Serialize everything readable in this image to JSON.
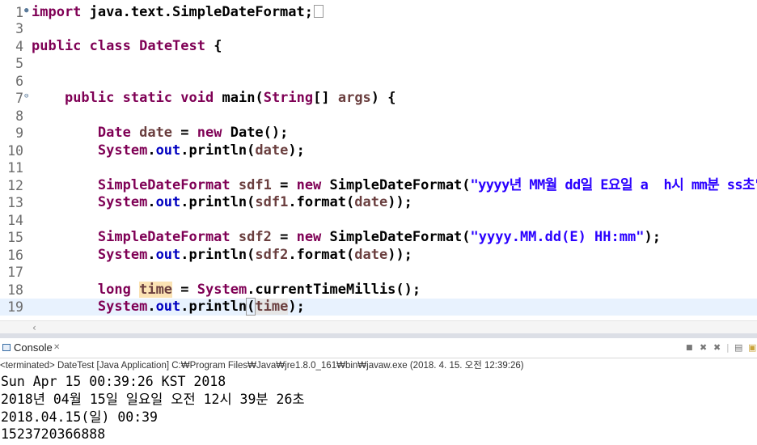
{
  "editor": {
    "line_numbers": [
      "1",
      "3",
      "4",
      "5",
      "6",
      "7",
      "8",
      "9",
      "10",
      "11",
      "12",
      "13",
      "14",
      "15",
      "16",
      "17",
      "18",
      "19"
    ],
    "l1": {
      "kw": "import",
      "rest": " java.text.SimpleDateFormat;"
    },
    "l4": {
      "kw1": "public",
      "kw2": "class",
      "name": "DateTest",
      "brace": " {"
    },
    "l7": {
      "kw1": "public",
      "kw2": "static",
      "kw3": "void",
      "method": "main",
      "p1": "(",
      "type": "String",
      "p2": "[] ",
      "arg": "args",
      "p3": ") {"
    },
    "l9": {
      "type": "Date",
      "var": "date",
      "eq": " = ",
      "kw": "new",
      "rest": " Date();"
    },
    "l10": {
      "cls": "System",
      "dot": ".",
      "field": "out",
      "call": ".println(",
      "var": "date",
      "end": ");"
    },
    "l12": {
      "type": "SimpleDateFormat",
      "var": "sdf1",
      "eq": " = ",
      "kw": "new",
      "ctor": " SimpleDateFormat(",
      "str": "\"yyyy년 MM월 dd일 E요일 a  h시 mm분 ss초\"",
      "end": ");"
    },
    "l13": {
      "cls": "System",
      "dot": ".",
      "field": "out",
      "call": ".println(",
      "var": "sdf1",
      "fmt": ".format(",
      "arg": "date",
      "end": "));"
    },
    "l15": {
      "type": "SimpleDateFormat",
      "var": "sdf2",
      "eq": " = ",
      "kw": "new",
      "ctor": " SimpleDateFormat(",
      "str": "\"yyyy.MM.dd(E) HH:mm\"",
      "end": ");"
    },
    "l16": {
      "cls": "System",
      "dot": ".",
      "field": "out",
      "call": ".println(",
      "var": "sdf2",
      "fmt": ".format(",
      "arg": "date",
      "end": "));"
    },
    "l18": {
      "kw": "long",
      "var": "time",
      "eq": " = ",
      "cls": "System",
      "call": ".currentTimeMillis();"
    },
    "l19": {
      "cls": "System",
      "dot": ".",
      "field": "out",
      "call": ".println",
      "paren": "(",
      "var": "time",
      "end": ");"
    }
  },
  "console": {
    "tab_label": "Console",
    "tab_close": "✕",
    "status": "<terminated> DateTest [Java Application] C:₩Program Files₩Java₩jre1.8.0_161₩bin₩javaw.exe (2018. 4. 15. 오전 12:39:26)",
    "output": [
      "Sun Apr 15 00:39:26 KST 2018",
      "2018년 04월 15일 일요일 오전 12시 39분 26초",
      "2018.04.15(일) 00:39",
      "1523720366888"
    ]
  }
}
